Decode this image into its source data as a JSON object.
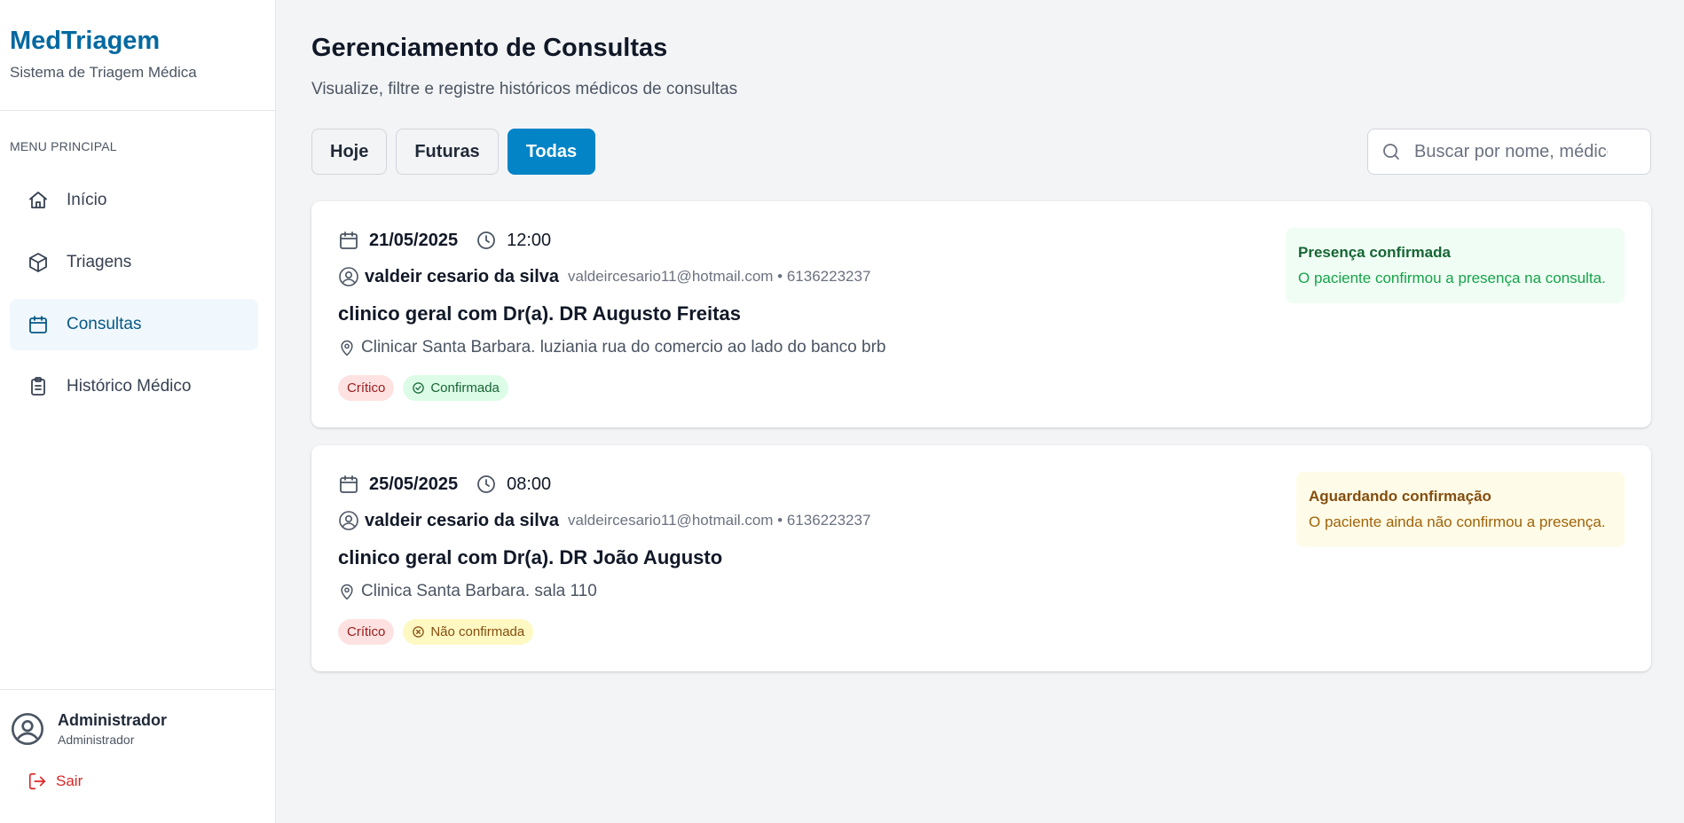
{
  "sidebar": {
    "brand_title": "MedTriagem",
    "brand_subtitle": "Sistema de Triagem Médica",
    "menu_label": "MENU PRINCIPAL",
    "items": [
      {
        "label": "Início",
        "icon": "home-icon"
      },
      {
        "label": "Triagens",
        "icon": "cube-icon"
      },
      {
        "label": "Consultas",
        "icon": "calendar-icon",
        "active": true
      },
      {
        "label": "Histórico Médico",
        "icon": "clipboard-icon"
      }
    ],
    "user": {
      "name": "Administrador",
      "role": "Administrador"
    },
    "logout_label": "Sair"
  },
  "main": {
    "title": "Gerenciamento de Consultas",
    "subtitle": "Visualize, filtre e registre históricos médicos de consultas",
    "filters": [
      {
        "label": "Hoje",
        "active": false
      },
      {
        "label": "Futuras",
        "active": false
      },
      {
        "label": "Todas",
        "active": true
      }
    ],
    "search": {
      "placeholder": "Buscar por nome, médico..."
    }
  },
  "consultas": [
    {
      "date": "21/05/2025",
      "time": "12:00",
      "patient_name": "valdeir cesario da silva",
      "patient_contact": "valdeircesario11@hotmail.com • 6136223237",
      "title": "clinico geral com Dr(a). DR Augusto Freitas",
      "location": "Clinicar Santa Barbara. luziania rua do comercio ao lado do banco brb",
      "priority_badge": "Crítico",
      "status_badge": "Confirmada",
      "status_title": "Presença confirmada",
      "status_description": "O paciente confirmou a presença na consulta."
    },
    {
      "date": "25/05/2025",
      "time": "08:00",
      "patient_name": "valdeir cesario da silva",
      "patient_contact": "valdeircesario11@hotmail.com • 6136223237",
      "title": "clinico geral com Dr(a). DR João Augusto",
      "location": "Clinica Santa Barbara. sala 110",
      "priority_badge": "Crítico",
      "status_badge": "Não confirmada",
      "status_title": "Aguardando confirmação",
      "status_description": "O paciente ainda não confirmou a presença."
    }
  ],
  "colors": {
    "brand": "#0369a1",
    "accent": "#0284c7",
    "critical_bg": "#fee2e2",
    "confirmed_bg": "#dcfce7",
    "pending_bg": "#fef9c3",
    "logout": "#dc2626"
  }
}
